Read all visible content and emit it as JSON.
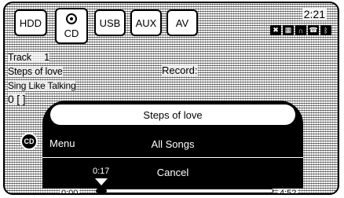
{
  "sources": {
    "hdd": "HDD",
    "cd": "CD",
    "usb": "USB",
    "aux": "AUX",
    "av": "AV"
  },
  "status": {
    "time": "2:21",
    "icons": [
      "signal-icon",
      "phone-book-icon",
      "headphones-icon",
      "phone-icon",
      "bluetooth-icon"
    ]
  },
  "track_info": {
    "track_label": "Track",
    "track_number": "1",
    "song_title": "Steps of love",
    "album": "Sing Like Talking",
    "folder": "0 [ ]",
    "record_label": "Record:"
  },
  "popup": {
    "title": "Steps of love",
    "cd_badge": "CD",
    "menu_label": "Menu",
    "items": [
      "All Songs",
      "Cancel"
    ]
  },
  "progress": {
    "start": "0:00",
    "current": "0:17",
    "end": "4:52",
    "fraction": 0.058
  }
}
